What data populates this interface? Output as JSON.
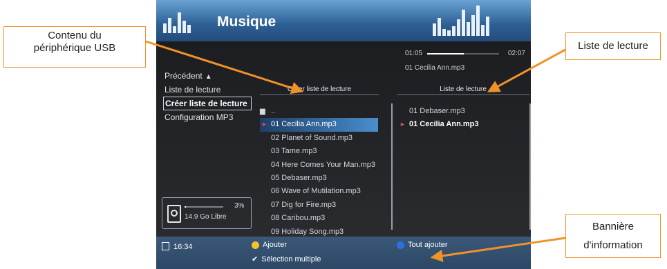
{
  "app": {
    "title": "Musique"
  },
  "progress": {
    "elapsed": "01:05",
    "total": "02:07",
    "fraction": 0.51,
    "now_playing": "01 Cecilia Ann.mp3"
  },
  "menu": [
    {
      "label": "Précédent"
    },
    {
      "label": "Liste de lecture"
    },
    {
      "label": "Créer liste de lecture",
      "selected": true
    },
    {
      "label": "Configuration MP3"
    }
  ],
  "columns": {
    "usb_header": "Créer liste de lecture",
    "playlist_header": "Liste de lecture"
  },
  "usb_files": [
    "01 Cecilia Ann.mp3",
    "02 Planet of Sound.mp3",
    "03 Tame.mp3",
    "04 Here Comes Your Man.mp3",
    "05 Debaser.mp3",
    "06 Wave of Mutilation.mp3",
    "07 Dig for Fire.mp3",
    "08 Caribou.mp3",
    "09 Holiday Song.mp3"
  ],
  "usb_folder_up": "..",
  "playlist": [
    "01 Debaser.mp3",
    "01 Cecilia Ann.mp3"
  ],
  "storage": {
    "percent": "3%",
    "used_fraction": 0.03,
    "free": "14.9 Go Libre"
  },
  "statusbar": {
    "time": "16:34",
    "add": "Ajouter",
    "add_all": "Tout ajouter",
    "multi_select": "Sélection multiple"
  },
  "callouts": {
    "usb_line1": "Contenu du",
    "usb_line2": "périphérique USB",
    "playlist": "Liste de lecture",
    "info_line1": "Bannière",
    "info_line2": "d'information"
  },
  "colors": {
    "accent_orange": "#f0922b",
    "highlight_blue": "#4a8ed0",
    "add_button": "#f2c230",
    "add_all_button": "#2f6fe0"
  }
}
